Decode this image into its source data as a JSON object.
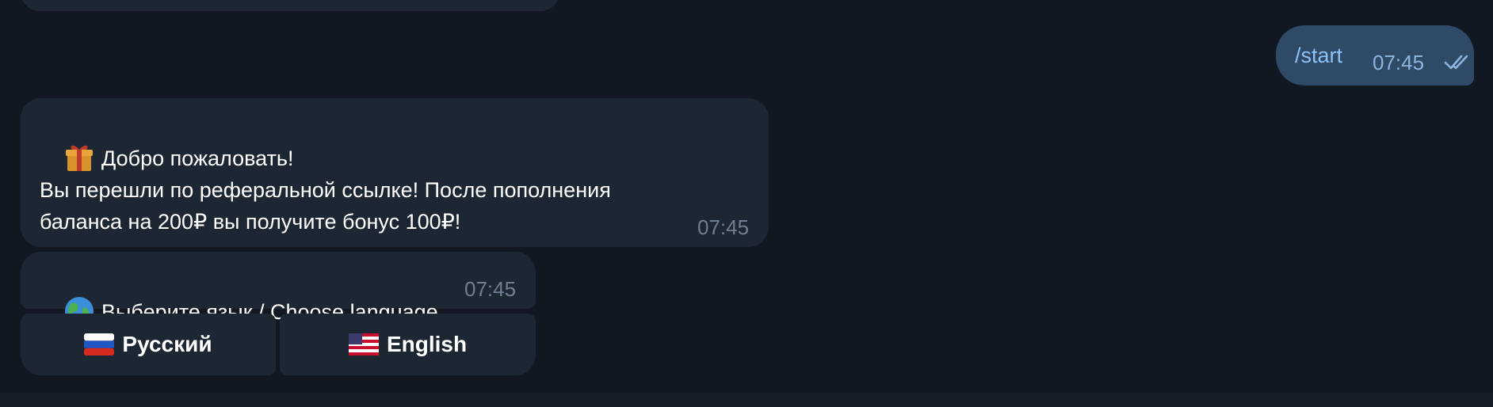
{
  "chat": {
    "outgoing": {
      "text": "/start",
      "time": "07:45",
      "status_icon": "double-check-icon"
    },
    "welcome": {
      "emoji": "gift-icon",
      "line1": "Добро пожаловать!",
      "line2": "Вы перешли по реферальной ссылке! После пополнения",
      "line3": "баланса на 200₽ вы получите бонус 100₽!",
      "time": "07:45"
    },
    "language_prompt": {
      "emoji": "globe-icon",
      "text": "Выберите язык / Choose language",
      "time": "07:45"
    },
    "keyboard": {
      "buttons": [
        {
          "flag": "russia-flag-icon",
          "label": "Русский"
        },
        {
          "flag": "usa-flag-icon",
          "label": "English"
        }
      ]
    }
  },
  "colors": {
    "background": "#111821",
    "incoming_bubble": "#1d2733",
    "outgoing_bubble": "#2f4a66",
    "time_text": "#6f7f90",
    "command_link": "#8ec2f5"
  }
}
